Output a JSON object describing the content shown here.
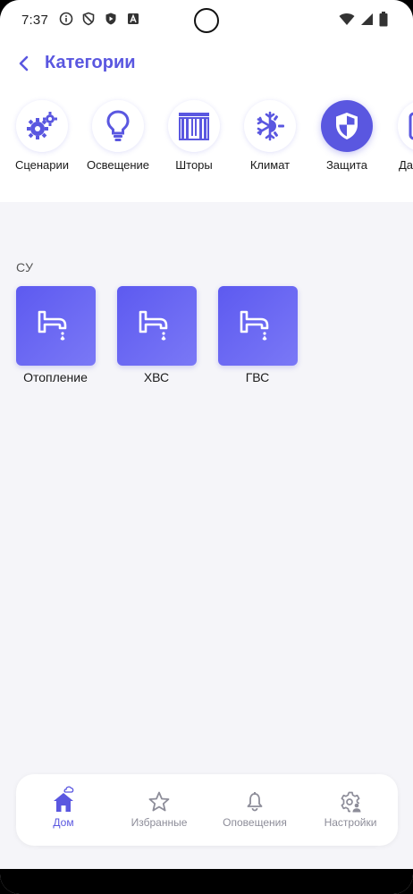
{
  "status_bar": {
    "time": "7:37",
    "icons": [
      "info-icon",
      "shield-outline-icon",
      "play-shield-icon",
      "a-badge-icon"
    ],
    "right_icons": [
      "wifi-icon",
      "signal-icon",
      "battery-icon"
    ]
  },
  "header": {
    "title": "Категории"
  },
  "categories": [
    {
      "label": "Сценарии",
      "icon": "gears-icon",
      "active": false
    },
    {
      "label": "Освещение",
      "icon": "lightbulb-icon",
      "active": false
    },
    {
      "label": "Шторы",
      "icon": "curtains-icon",
      "active": false
    },
    {
      "label": "Климат",
      "icon": "climate-icon",
      "active": false
    },
    {
      "label": "Защита",
      "icon": "shield-icon",
      "active": true
    },
    {
      "label": "Да",
      "icon": "sensor-icon",
      "active": false
    }
  ],
  "section": {
    "title": "СУ",
    "devices": [
      {
        "label": "Отопление",
        "icon": "faucet-icon"
      },
      {
        "label": "ХВС",
        "icon": "faucet-icon"
      },
      {
        "label": "ГВС",
        "icon": "faucet-icon"
      }
    ]
  },
  "bottom_nav": [
    {
      "label": "Дом",
      "icon": "home-icon",
      "active": true
    },
    {
      "label": "Избранные",
      "icon": "star-icon",
      "active": false
    },
    {
      "label": "Оповещения",
      "icon": "bell-icon",
      "active": false
    },
    {
      "label": "Настройки",
      "icon": "settings-user-icon",
      "active": false
    }
  ],
  "colors": {
    "accent": "#5a57e0",
    "background": "#f5f5f9",
    "inactive": "#8d8d99"
  }
}
